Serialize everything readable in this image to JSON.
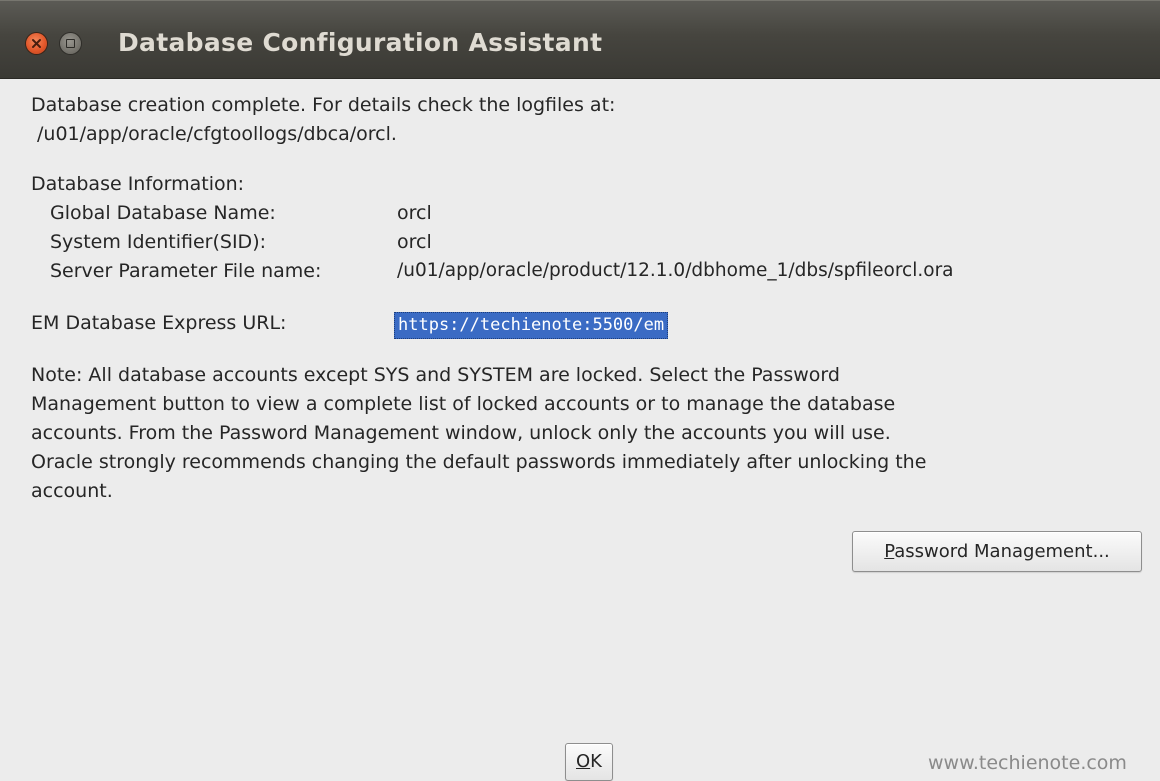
{
  "window": {
    "title": "Database Configuration Assistant"
  },
  "completion": {
    "line1": "Database creation complete. For details check the logfiles at:",
    "line2": "/u01/app/oracle/cfgtoollogs/dbca/orcl."
  },
  "info": {
    "heading": "Database Information:",
    "rows": [
      {
        "label": "Global Database Name:",
        "value": "orcl"
      },
      {
        "label": "System Identifier(SID):",
        "value": "orcl"
      },
      {
        "label": "Server Parameter File name:",
        "value": "/u01/app/oracle/product/12.1.0/dbhome_1/dbs/spfileorcl.ora"
      }
    ]
  },
  "em": {
    "label": "EM Database Express URL:",
    "url": "https://techienote:5500/em"
  },
  "note": {
    "lines": [
      "Note: All database accounts except SYS and SYSTEM are locked. Select the Password",
      "Management button to view a complete list of locked accounts or to manage the database",
      "accounts. From the Password Management window, unlock only the accounts you will use.",
      "Oracle strongly recommends changing the default passwords immediately after unlocking the",
      "account."
    ]
  },
  "buttons": {
    "password_mnemonic": "P",
    "password_rest": "assword Management...",
    "ok_mnemonic": "O",
    "ok_rest": "K"
  },
  "watermark": "www.techienote.com"
}
